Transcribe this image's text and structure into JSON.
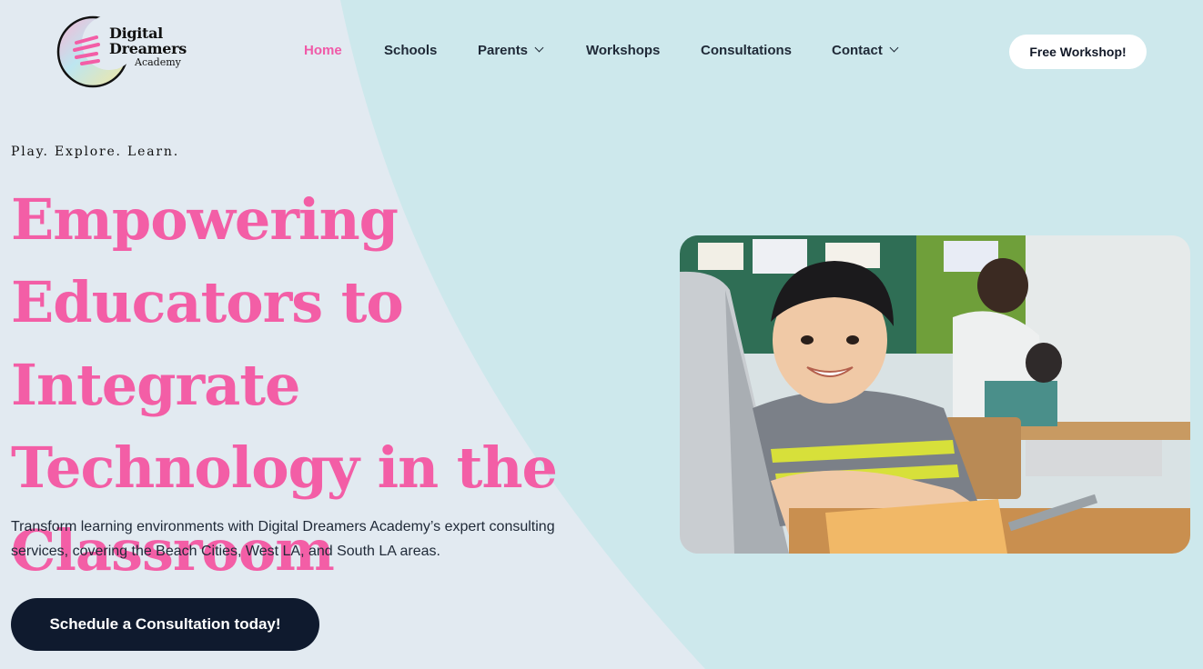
{
  "logo": {
    "line1": "Digital",
    "line2": "Dreamers",
    "line3": "Academy",
    "icon": "crescent-moon-logo-icon"
  },
  "nav": {
    "items": [
      {
        "label": "Home",
        "active": true,
        "has_dropdown": false
      },
      {
        "label": "Schools",
        "active": false,
        "has_dropdown": false
      },
      {
        "label": "Parents",
        "active": false,
        "has_dropdown": true
      },
      {
        "label": "Workshops",
        "active": false,
        "has_dropdown": false
      },
      {
        "label": "Consultations",
        "active": false,
        "has_dropdown": false
      },
      {
        "label": "Contact",
        "active": false,
        "has_dropdown": true
      }
    ],
    "cta": "Free Workshop!"
  },
  "hero": {
    "tagline": "Play. Explore. Learn.",
    "title": "Empowering Educators to Integrate Technology in the Classroom",
    "description": "Transform learning environments with Digital Dreamers Academy’s expert consulting services, covering the Beach Cities, West LA, and South LA areas.",
    "cta": "Schedule a Consultation today!",
    "image": "smiling-boy-at-laptop-in-classroom-photo"
  },
  "colors": {
    "accent_pink": "#f35ea6",
    "nav_active": "#f05aa8",
    "dark_button": "#0f1a2e",
    "background_teal": "#cde8ec",
    "background_light": "#e2eaf1"
  }
}
